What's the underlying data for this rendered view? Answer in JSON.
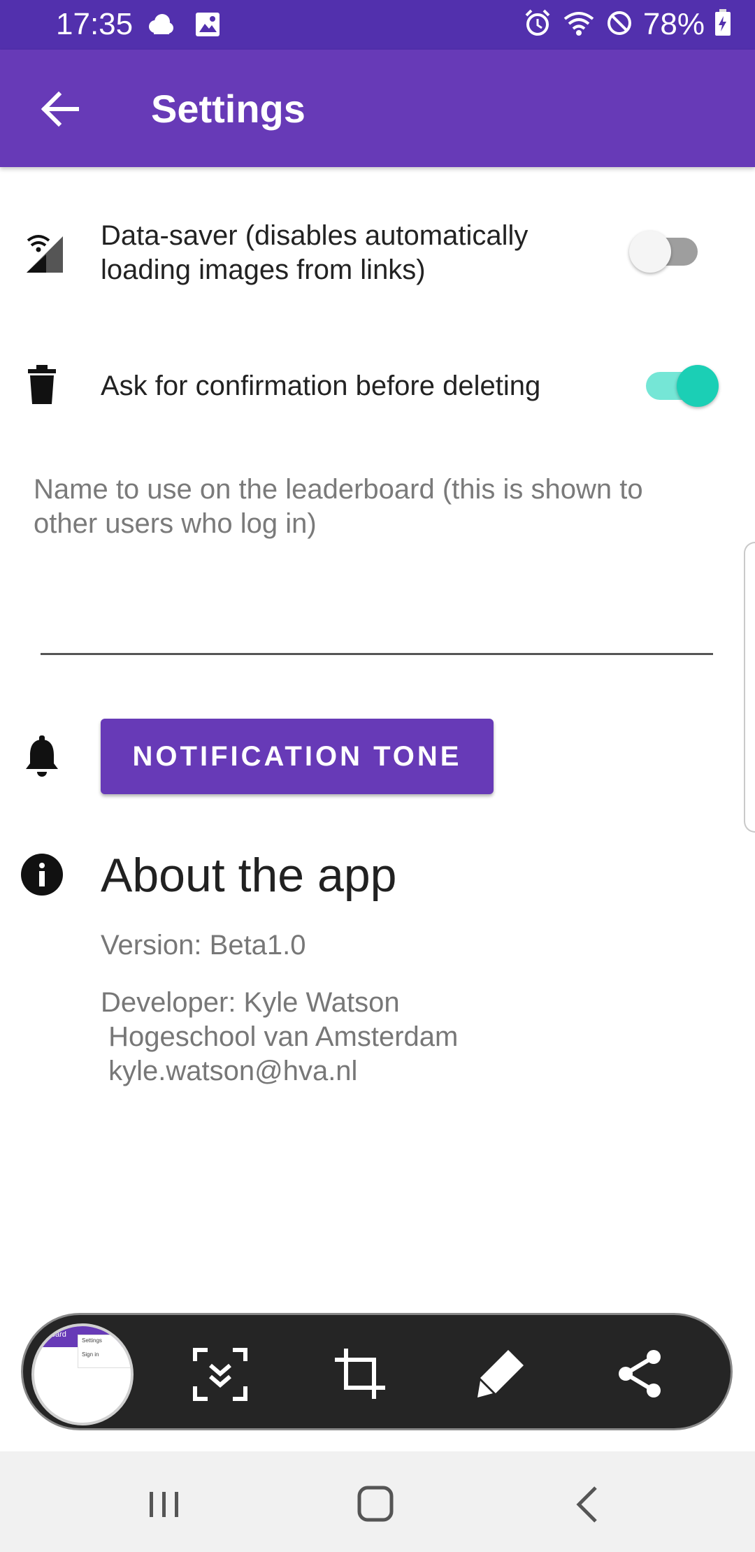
{
  "status_bar": {
    "time": "17:35",
    "battery": "78%",
    "left_icons": [
      "cloud-icon",
      "image-icon"
    ],
    "right_icons": [
      "alarm-icon",
      "wifi-icon",
      "do-not-disturb-icon",
      "battery-charging-icon"
    ]
  },
  "app_bar": {
    "title": "Settings",
    "back_icon": "arrow-back-icon",
    "color": "#673ab7"
  },
  "settings": {
    "data_saver": {
      "icon": "signal-icon",
      "label": "Data-saver (disables automatically loading images from links)",
      "enabled": false
    },
    "confirm_delete": {
      "icon": "trash-icon",
      "label": "Ask for confirmation before deleting",
      "enabled": true
    },
    "leaderboard_name": {
      "hint": "Name to use on the leaderboard (this is shown to other users who log in)",
      "value": ""
    },
    "notification_tone": {
      "icon": "bell-icon",
      "button_label": "NOTIFICATION TONE"
    }
  },
  "about": {
    "icon": "info-icon",
    "title": "About the app",
    "version": "Version: Beta1.0",
    "developer": "Developer: Kyle Watson\n Hogeschool van Amsterdam\n kyle.watson@hva.nl"
  },
  "screenshot_toolbar": {
    "thumbnail": {
      "label": "erboard",
      "item1": "Settings",
      "item2": "Sign in"
    },
    "tools": [
      "scroll-capture-icon",
      "crop-icon",
      "pen-icon",
      "share-icon"
    ]
  },
  "nav_bar": {
    "buttons": [
      "recent-apps-icon",
      "home-icon",
      "back-icon"
    ]
  },
  "colors": {
    "status_bar": "#5230ad",
    "primary": "#673ab7",
    "switch_on": "#1bcfb5",
    "switch_off": "#9e9e9e"
  }
}
